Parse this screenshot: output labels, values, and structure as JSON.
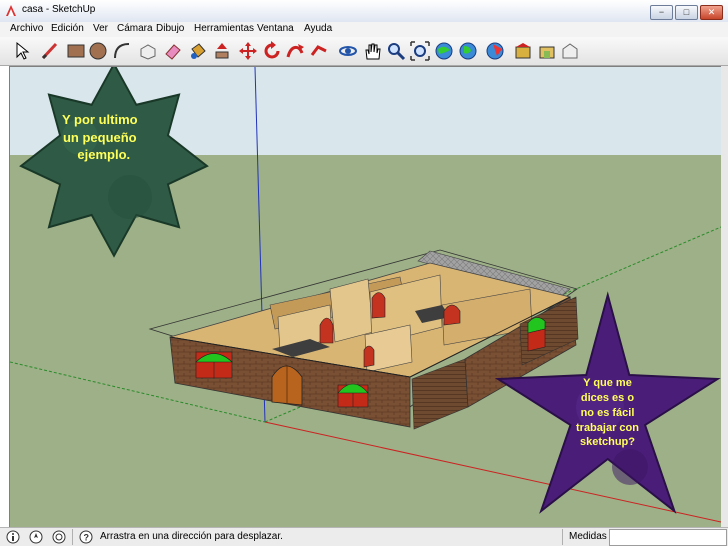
{
  "window": {
    "title": "casa - SketchUp",
    "minimize": "−",
    "maximize": "□",
    "close": "✕"
  },
  "menubar": [
    "Archivo",
    "Edición",
    "Ver",
    "Cámara",
    "Dibujo",
    "Herramientas",
    "Ventana",
    "Ayuda"
  ],
  "toolbar": {
    "tools": [
      "select-arrow-icon",
      "line-pencil-icon",
      "rectangle-icon",
      "circle-icon",
      "arc-icon",
      "make-component-icon",
      "eraser-icon",
      "paint-bucket-icon",
      "push-pull-icon",
      "move-icon",
      "rotate-icon",
      "follow-me-icon",
      "orbit-icon",
      "pan-hand-icon",
      "zoom-icon",
      "zoom-extents-icon",
      "get-models-icon",
      "share-model-icon",
      "component-icon",
      "share-component-icon",
      "warehouse-icon"
    ]
  },
  "callouts": {
    "first": {
      "lines": [
        "Y por ultimo",
        "un pequeño",
        "ejemplo."
      ]
    },
    "second": {
      "lines": [
        "Y que me",
        "dices es o",
        "no es fácil",
        "trabajar con",
        "sketchup?"
      ]
    }
  },
  "colors": {
    "sky": "#d9e6ec",
    "ground": "#9db087",
    "star_green": "#2f5a45",
    "star_purple": "#4a1e78",
    "callout_text": "#ffff5a",
    "wall_brick": "#7a5034",
    "floor_wood": "#d9b574",
    "window_green": "#22c41e",
    "window_red": "#c42a18",
    "roof_gray": "#9a9a9a"
  },
  "statusbar": {
    "icons": [
      "info-icon",
      "geo-location-icon",
      "credits-icon",
      "help-icon"
    ],
    "text": "Arrastra en una dirección para desplazar.",
    "measures_label": "Medidas",
    "measures_value": ""
  }
}
